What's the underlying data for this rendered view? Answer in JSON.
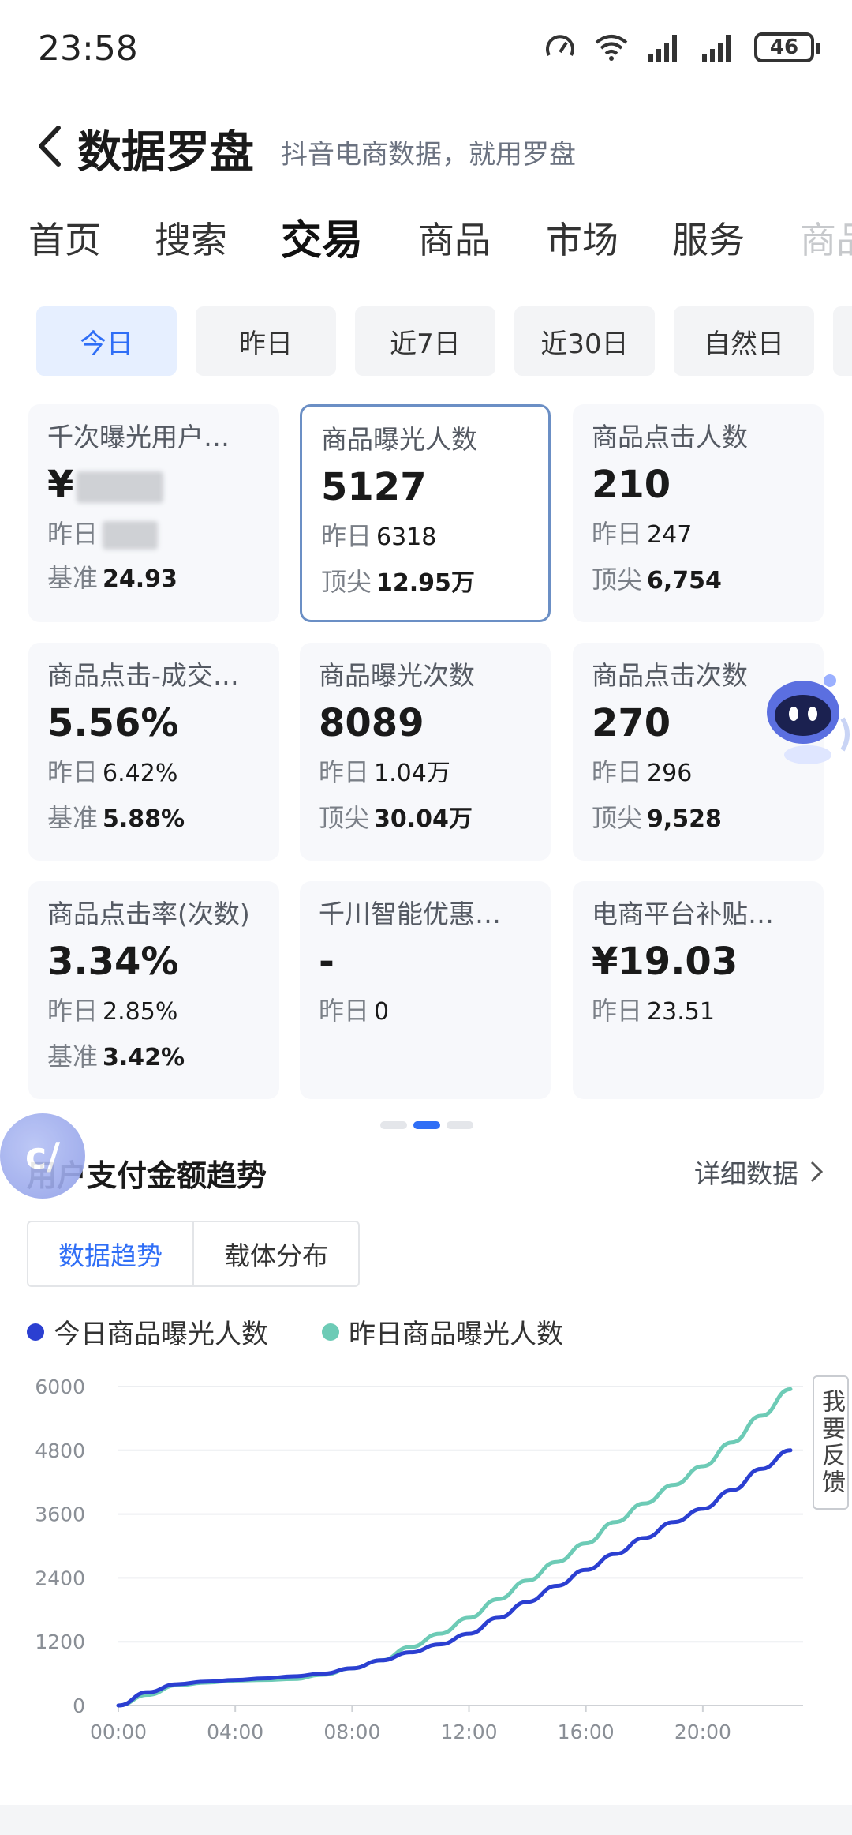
{
  "status": {
    "time": "23:58",
    "battery": "46"
  },
  "header": {
    "title": "数据罗盘",
    "subtitle": "抖音电商数据，就用罗盘"
  },
  "tabs": [
    {
      "label": "首页"
    },
    {
      "label": "搜索"
    },
    {
      "label": "交易",
      "active": true
    },
    {
      "label": "商品"
    },
    {
      "label": "市场"
    },
    {
      "label": "服务"
    },
    {
      "label": "商品"
    }
  ],
  "date_chips": [
    {
      "label": "今日",
      "active": true
    },
    {
      "label": "昨日"
    },
    {
      "label": "近7日"
    },
    {
      "label": "近30日"
    },
    {
      "label": "自然日"
    }
  ],
  "cards": [
    {
      "title": "千次曝光用户…",
      "value": "¥",
      "row1_label": "昨日",
      "row1_value": "",
      "row2_label": "基准",
      "row2_value": "24.93"
    },
    {
      "title": "商品曝光人数",
      "value": "5127",
      "row1_label": "昨日",
      "row1_value": "6318",
      "row2_label": "顶尖",
      "row2_value": "12.95万"
    },
    {
      "title": "商品点击人数",
      "value": "210",
      "row1_label": "昨日",
      "row1_value": "247",
      "row2_label": "顶尖",
      "row2_value": "6,754"
    },
    {
      "title": "商品点击-成交…",
      "value": "5.56%",
      "row1_label": "昨日",
      "row1_value": "6.42%",
      "row2_label": "基准",
      "row2_value": "5.88%"
    },
    {
      "title": "商品曝光次数",
      "value": "8089",
      "row1_label": "昨日",
      "row1_value": "1.04万",
      "row2_label": "顶尖",
      "row2_value": "30.04万"
    },
    {
      "title": "商品点击次数",
      "value": "270",
      "row1_label": "昨日",
      "row1_value": "296",
      "row2_label": "顶尖",
      "row2_value": "9,528"
    },
    {
      "title": "商品点击率(次数)",
      "value": "3.34%",
      "row1_label": "昨日",
      "row1_value": "2.85%",
      "row2_label": "基准",
      "row2_value": "3.42%"
    },
    {
      "title": "千川智能优惠…",
      "value": "-",
      "row1_label": "昨日",
      "row1_value": "0"
    },
    {
      "title": "电商平台补贴…",
      "value": "¥19.03",
      "row1_label": "昨日",
      "row1_value": "23.51"
    }
  ],
  "section": {
    "title": "用户支付金额趋势",
    "detail_link": "详细数据"
  },
  "segmented": {
    "trend": "数据趋势",
    "carrier": "载体分布"
  },
  "feedback": "我要反馈",
  "colors": {
    "accent": "#2f6ef6",
    "today_line": "#2b3fd1",
    "yesterday_line": "#6dcbb6"
  },
  "chart_data": {
    "type": "line",
    "x": [
      "00:00",
      "01:00",
      "02:00",
      "03:00",
      "04:00",
      "05:00",
      "06:00",
      "07:00",
      "08:00",
      "09:00",
      "10:00",
      "11:00",
      "12:00",
      "13:00",
      "14:00",
      "15:00",
      "16:00",
      "17:00",
      "18:00",
      "19:00",
      "20:00",
      "21:00",
      "22:00",
      "23:00"
    ],
    "xticks": [
      "00:00",
      "04:00",
      "08:00",
      "12:00",
      "16:00",
      "20:00"
    ],
    "yticks": [
      "0",
      "1200",
      "2400",
      "3600",
      "4800",
      "6000"
    ],
    "ylim": [
      0,
      6000
    ],
    "grid": true,
    "legend_position": "top-left",
    "series": [
      {
        "name": "今日商品曝光人数",
        "color": "#2b3fd1",
        "values": [
          0,
          250,
          400,
          450,
          480,
          510,
          550,
          600,
          700,
          850,
          1000,
          1150,
          1350,
          1650,
          1950,
          2250,
          2550,
          2850,
          3150,
          3450,
          3700,
          4050,
          4450,
          4800
        ]
      },
      {
        "name": "昨日商品曝光人数",
        "color": "#6dcbb6",
        "values": [
          0,
          200,
          380,
          430,
          470,
          480,
          500,
          580,
          700,
          850,
          1100,
          1350,
          1650,
          2000,
          2350,
          2700,
          3050,
          3450,
          3800,
          4150,
          4500,
          4950,
          5450,
          5950
        ]
      }
    ]
  }
}
